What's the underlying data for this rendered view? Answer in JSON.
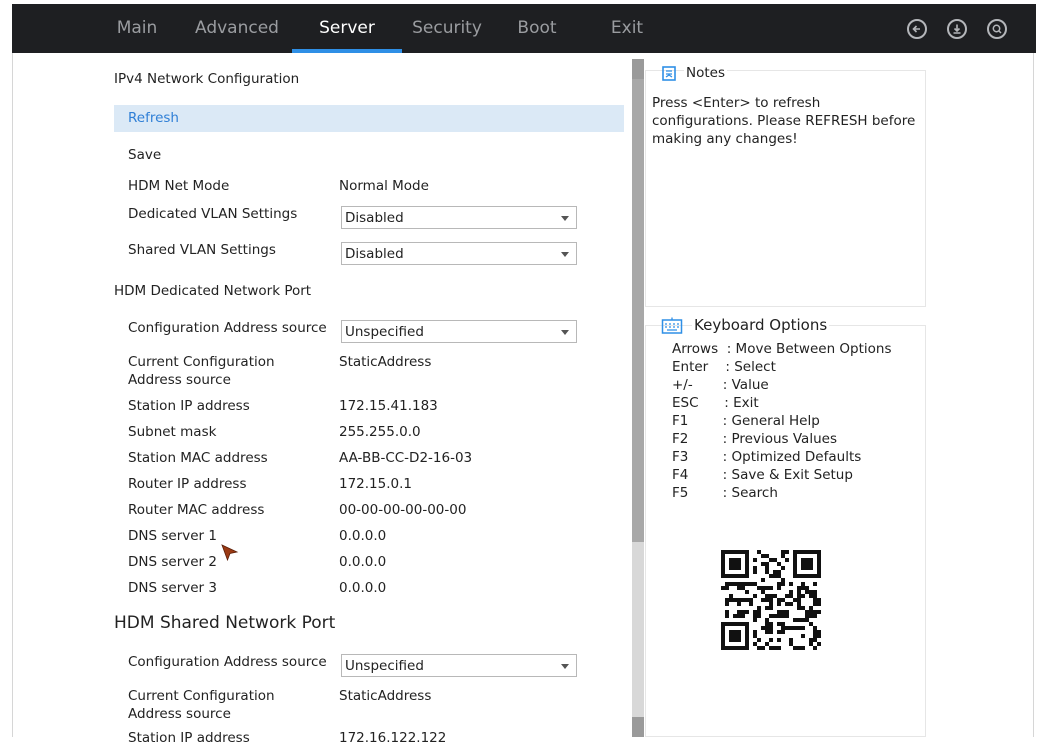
{
  "tabs": [
    {
      "label": "Main",
      "active": false
    },
    {
      "label": "Advanced",
      "active": false
    },
    {
      "label": "Server",
      "active": true
    },
    {
      "label": "Security",
      "active": false
    },
    {
      "label": "Boot",
      "active": false
    },
    {
      "label": "Exit",
      "active": false
    }
  ],
  "top_icons": [
    "back-arrow-icon",
    "download-icon",
    "search-icon"
  ],
  "accent_color": "#2f8fe6",
  "content": {
    "ipv4_title": "IPv4 Network Configuration",
    "refresh_label": "Refresh",
    "save_label": "Save",
    "hdm_net_mode_label": "HDM Net Mode",
    "hdm_net_mode_value": "Normal Mode",
    "dedicated_vlan_label": "Dedicated VLAN Settings",
    "dedicated_vlan_value": "Disabled",
    "shared_vlan_label": "Shared VLAN Settings",
    "shared_vlan_value": "Disabled",
    "dedicated_port_title": "HDM Dedicated Network Port",
    "dedicated": {
      "config_source_label": "Configuration Address source",
      "config_source_value": "Unspecified",
      "current_source_label": "Current Configuration Address source",
      "current_source_value": "StaticAddress",
      "station_ip_label": "Station IP address",
      "station_ip_value": "172.15.41.183",
      "subnet_label": "Subnet mask",
      "subnet_value": "255.255.0.0",
      "station_mac_label": "Station MAC address",
      "station_mac_value": "AA-BB-CC-D2-16-03",
      "router_ip_label": "Router IP address",
      "router_ip_value": "172.15.0.1",
      "router_mac_label": "Router MAC address",
      "router_mac_value": "00-00-00-00-00-00",
      "dns1_label": "DNS server 1",
      "dns1_value": "0.0.0.0",
      "dns2_label": "DNS server 2",
      "dns2_value": "0.0.0.0",
      "dns3_label": "DNS server 3",
      "dns3_value": "0.0.0.0"
    },
    "shared_port_title": "HDM Shared Network Port",
    "shared": {
      "config_source_label": "Configuration Address source",
      "config_source_value": "Unspecified",
      "current_source_label": "Current Configuration Address source",
      "current_source_value": "StaticAddress",
      "station_ip_label_partial": "Station IP address",
      "station_ip_value_partial": "172.16.122.122"
    }
  },
  "notes": {
    "title": "Notes",
    "text": "Press <Enter> to refresh configurations. Please REFRESH before making any changes!"
  },
  "keyboard": {
    "title": "Keyboard Options",
    "lines": [
      "Arrows  : Move Between Options",
      "Enter    : Select",
      "+/-       : Value",
      "ESC      : Exit",
      "F1        : General Help",
      "F2        : Previous Values",
      "F3        : Optimized Defaults",
      "F4        : Save & Exit Setup",
      "F5        : Search"
    ]
  }
}
